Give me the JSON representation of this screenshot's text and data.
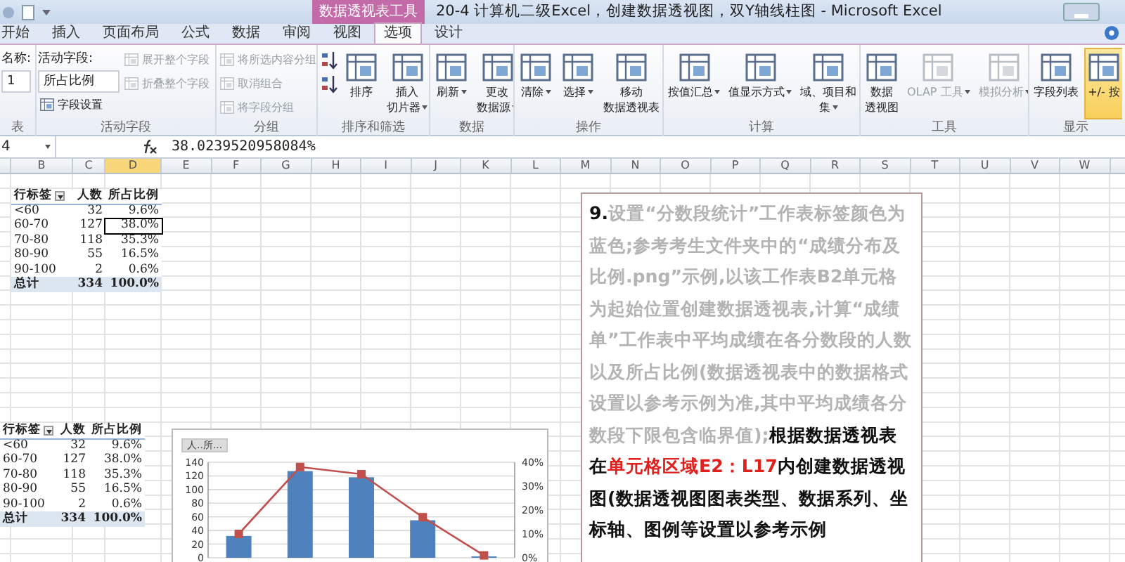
{
  "window": {
    "title": "20-4 计算机二级Excel，创建数据透视图，双Y轴线柱图 - Microsoft Excel",
    "context_tab": "数据透视表工具"
  },
  "tabs": [
    {
      "label": "开始",
      "selected": false
    },
    {
      "label": "插入",
      "selected": false
    },
    {
      "label": "页面布局",
      "selected": false
    },
    {
      "label": "公式",
      "selected": false
    },
    {
      "label": "数据",
      "selected": false
    },
    {
      "label": "审阅",
      "selected": false
    },
    {
      "label": "视图",
      "selected": false
    },
    {
      "label": "选项",
      "selected": true
    },
    {
      "label": "设计",
      "selected": false
    }
  ],
  "ribbon_groups": [
    {
      "label": "表",
      "items": [
        {
          "kind": "label",
          "text": "名称:"
        },
        {
          "kind": "field",
          "value": "1"
        }
      ]
    },
    {
      "label": "活动字段",
      "items": [
        {
          "kind": "label",
          "text": "活动字段:"
        },
        {
          "kind": "field",
          "value": "所占比例"
        },
        {
          "kind": "small",
          "text": "字段设置",
          "disabled": false
        },
        {
          "kind": "small",
          "text": "展开整个字段",
          "disabled": true
        },
        {
          "kind": "small",
          "text": "折叠整个字段",
          "disabled": true
        }
      ]
    },
    {
      "label": "分组",
      "items": [
        {
          "kind": "small",
          "text": "将所选内容分组",
          "disabled": true
        },
        {
          "kind": "small",
          "text": "取消组合",
          "disabled": true
        },
        {
          "kind": "small",
          "text": "将字段分组",
          "disabled": true
        }
      ]
    },
    {
      "label": "排序和筛选",
      "items": [
        {
          "kind": "icon",
          "disabled": false
        },
        {
          "kind": "icon",
          "disabled": false
        },
        {
          "kind": "large",
          "lines": [
            "排序"
          ],
          "dropdown": false,
          "disabled": false
        },
        {
          "kind": "large",
          "lines": [
            "插入",
            "切片器"
          ],
          "dropdown": true,
          "disabled": false
        }
      ]
    },
    {
      "label": "数据",
      "items": [
        {
          "kind": "large",
          "lines": [
            "刷新"
          ],
          "dropdown": true,
          "disabled": false
        },
        {
          "kind": "large",
          "lines": [
            "更改",
            "数据源"
          ],
          "dropdown": true,
          "disabled": false
        }
      ]
    },
    {
      "label": "操作",
      "items": [
        {
          "kind": "large",
          "lines": [
            "清除"
          ],
          "dropdown": true,
          "disabled": false
        },
        {
          "kind": "large",
          "lines": [
            "选择"
          ],
          "dropdown": true,
          "disabled": false
        },
        {
          "kind": "large",
          "lines": [
            "移动",
            "数据透视表"
          ],
          "dropdown": false,
          "disabled": false
        }
      ]
    },
    {
      "label": "计算",
      "items": [
        {
          "kind": "large",
          "lines": [
            "按值汇总"
          ],
          "dropdown": true,
          "disabled": false
        },
        {
          "kind": "large",
          "lines": [
            "值显示方式"
          ],
          "dropdown": true,
          "disabled": false
        },
        {
          "kind": "large",
          "lines": [
            "域、项目和",
            "集"
          ],
          "dropdown": true,
          "disabled": false
        }
      ]
    },
    {
      "label": "工具",
      "items": [
        {
          "kind": "large",
          "lines": [
            "数据",
            "透视图"
          ],
          "dropdown": false,
          "disabled": false
        },
        {
          "kind": "large",
          "lines": [
            "OLAP 工具"
          ],
          "dropdown": true,
          "disabled": true
        },
        {
          "kind": "large",
          "lines": [
            "模拟分析"
          ],
          "dropdown": true,
          "disabled": true
        }
      ]
    },
    {
      "label": "显示",
      "items": [
        {
          "kind": "large",
          "lines": [
            "字段列表"
          ],
          "dropdown": false,
          "disabled": false,
          "on": false
        },
        {
          "kind": "large",
          "lines": [
            "+/- 按"
          ],
          "dropdown": false,
          "disabled": false,
          "on": true
        }
      ]
    }
  ],
  "formula_bar": {
    "name_box": "4",
    "formula": "38.0239520958084%"
  },
  "columns": [
    {
      "label": "B",
      "selected": false
    },
    {
      "label": "C",
      "selected": false
    },
    {
      "label": "D",
      "selected": true
    },
    {
      "label": "E",
      "selected": false
    },
    {
      "label": "F",
      "selected": false
    },
    {
      "label": "G",
      "selected": false
    },
    {
      "label": "H",
      "selected": false
    },
    {
      "label": "I",
      "selected": false
    },
    {
      "label": "J",
      "selected": false
    },
    {
      "label": "K",
      "selected": false
    },
    {
      "label": "L",
      "selected": false
    },
    {
      "label": "M",
      "selected": false
    },
    {
      "label": "N",
      "selected": false
    },
    {
      "label": "O",
      "selected": false
    },
    {
      "label": "P",
      "selected": false
    },
    {
      "label": "Q",
      "selected": false
    },
    {
      "label": "R",
      "selected": false
    },
    {
      "label": "S",
      "selected": false
    },
    {
      "label": "T",
      "selected": false
    },
    {
      "label": "U",
      "selected": false
    },
    {
      "label": "V",
      "selected": false
    },
    {
      "label": "W",
      "selected": false
    }
  ],
  "pivot_tables": [
    {
      "headers": [
        "行标签",
        "人数",
        "所占比例"
      ],
      "rows": [
        {
          "label": "<60",
          "count": "32",
          "share": "9.6%",
          "selected": false
        },
        {
          "label": "60-70",
          "count": "127",
          "share": "38.0%",
          "selected": true
        },
        {
          "label": "70-80",
          "count": "118",
          "share": "35.3%",
          "selected": false
        },
        {
          "label": "80-90",
          "count": "55",
          "share": "16.5%",
          "selected": false
        },
        {
          "label": "90-100",
          "count": "2",
          "share": "0.6%",
          "selected": false
        }
      ],
      "total": {
        "label": "总计",
        "count": "334",
        "share": "100.0%"
      }
    },
    {
      "headers": [
        "行标签",
        "人数",
        "所占比例"
      ],
      "rows": [
        {
          "label": "<60",
          "count": "32",
          "share": "9.6%",
          "selected": false
        },
        {
          "label": "60-70",
          "count": "127",
          "share": "38.0%",
          "selected": false
        },
        {
          "label": "70-80",
          "count": "118",
          "share": "35.3%",
          "selected": false
        },
        {
          "label": "80-90",
          "count": "55",
          "share": "16.5%",
          "selected": false
        },
        {
          "label": "90-100",
          "count": "2",
          "share": "0.6%",
          "selected": false
        }
      ],
      "total": {
        "label": "总计",
        "count": "334",
        "share": "100.0%"
      }
    }
  ],
  "chart": {
    "button": "人..所...",
    "chart_data": {
      "type": "bar",
      "grid": true,
      "ylim": [
        0,
        140
      ],
      "yticks": [
        0,
        20,
        40,
        60,
        80,
        100,
        120,
        140
      ],
      "series": [
        {
          "color": "#4f81bd",
          "values": [
            32,
            127,
            118,
            55,
            2
          ]
        },
        {
          "color": "#c0504d",
          "type": "line",
          "axis": "y2",
          "marker": "square",
          "values": [
            0.1,
            0.38,
            0.35,
            0.17,
            0.01
          ]
        }
      ],
      "y2lim": [
        0,
        0.4
      ],
      "y2ticks": [
        {
          "value": 0,
          "label": "0%"
        },
        {
          "value": 0.1,
          "label": "10%"
        },
        {
          "value": 0.2,
          "label": "20%"
        },
        {
          "value": 0.3,
          "label": "30%"
        },
        {
          "value": 0.4,
          "label": "40%"
        }
      ]
    }
  },
  "instruction": {
    "segments": [
      {
        "kind": "number",
        "text": "9."
      },
      {
        "kind": "muted",
        "text": "设置“分数段统计”工作表标签颜色为蓝色;参考考生文件夹中的“成绩分布及比例.png”示例,以该工作表B2单元格为起始位置创建数据透视表,计算“成绩单”工作表中平均成绩在各分数段的人数以及所占比例(数据透视表中的数据格式设置以参考示例为准,其中平均成绩各分数段下限包含临界值);"
      },
      {
        "kind": "plain",
        "text": "根据数据透视表在"
      },
      {
        "kind": "highlight",
        "text": "单元格区域E2：L17"
      },
      {
        "kind": "plain",
        "text": "内创建数据透视图(数据透视图图表类型、数据系列、坐标轴、图例等设置以参考示例"
      }
    ]
  }
}
